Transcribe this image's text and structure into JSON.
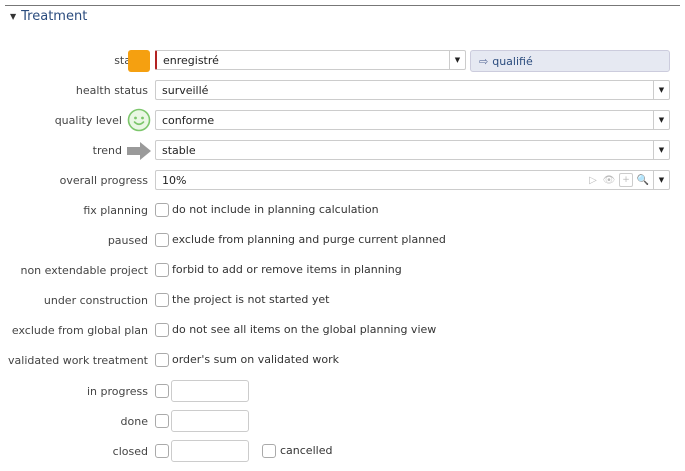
{
  "section": {
    "title": "Treatment"
  },
  "status": {
    "label": "status",
    "value": "enregistré",
    "swatch_color": "#f5a010",
    "next_status": "qualifié"
  },
  "health_status": {
    "label": "health status",
    "value": "surveillé"
  },
  "quality_level": {
    "label": "quality level",
    "value": "conforme",
    "icon": "smiley-icon"
  },
  "trend": {
    "label": "trend",
    "value": "stable",
    "icon": "arrow-right-icon"
  },
  "overall_progress": {
    "label": "overall progress",
    "value": "10%"
  },
  "fix_planning": {
    "label": "fix planning",
    "text": "do not include in planning calculation"
  },
  "paused": {
    "label": "paused",
    "text": "exclude from planning and purge current planned"
  },
  "non_extendable_project": {
    "label": "non extendable project",
    "text": "forbid to add or remove items in planning"
  },
  "under_construction": {
    "label": "under construction",
    "text": "the project is not started yet"
  },
  "exclude_from_global_plan": {
    "label": "exclude from global plan",
    "text": "do not see all items on the global planning view"
  },
  "validated_work_treatment": {
    "label": "validated work treatment",
    "text": "order's sum on validated work"
  },
  "in_progress": {
    "label": "in progress"
  },
  "done": {
    "label": "done"
  },
  "closed": {
    "label": "closed",
    "cancelled_label": "cancelled"
  }
}
